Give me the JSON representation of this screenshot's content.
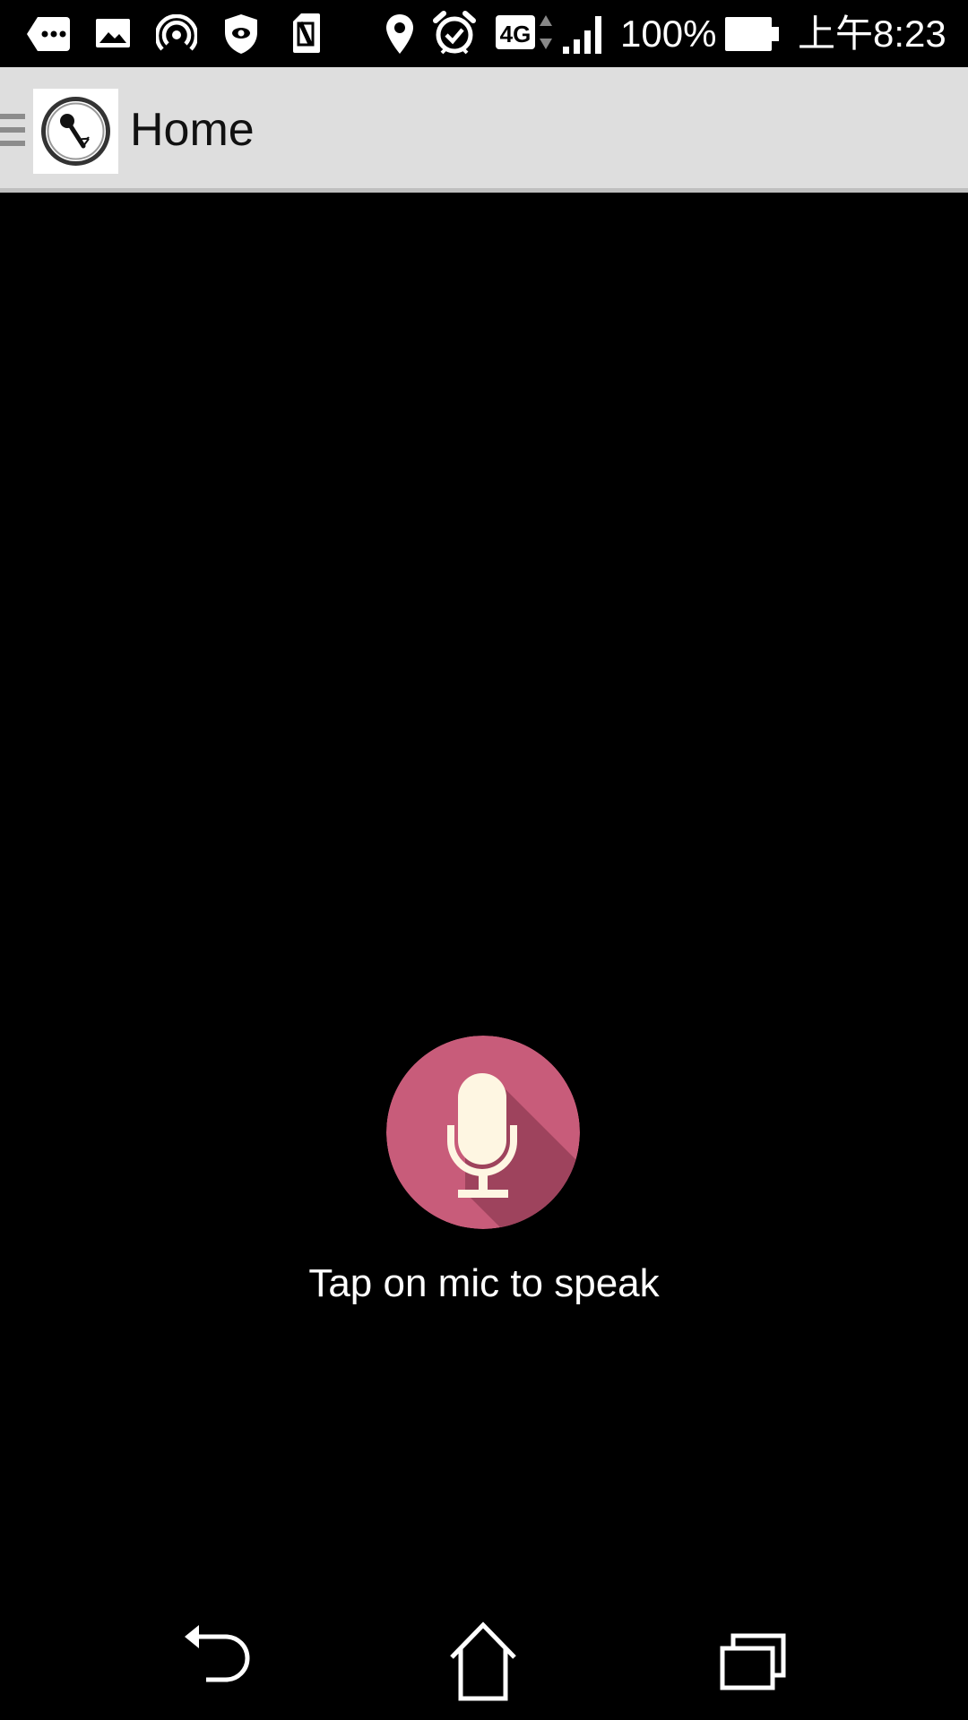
{
  "status_bar": {
    "icons": [
      "more-notifications-icon",
      "image-icon",
      "hotspot-icon",
      "shield-icon",
      "sim-icon",
      "location-icon",
      "alarm-icon",
      "network-4g-icon",
      "signal-icon",
      "battery-icon"
    ],
    "network": "4G",
    "battery_percent": "100%",
    "battery_level": 1.0,
    "time": "上午8:23"
  },
  "toolbar": {
    "title": "Home",
    "logo_icon": "microphone-logo-icon",
    "menu_icon": "drawer-menu-icon"
  },
  "main": {
    "mic_icon": "microphone-icon",
    "mic_color": "#c85c7a",
    "hint": "Tap on mic to speak"
  },
  "nav_bar": {
    "icons": [
      "back-icon",
      "home-icon",
      "recent-apps-icon"
    ]
  }
}
